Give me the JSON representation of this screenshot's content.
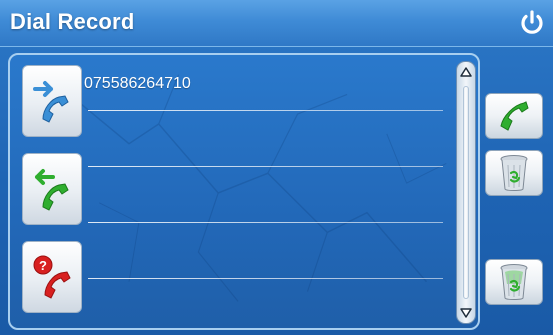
{
  "header": {
    "title": "Dial Record"
  },
  "records": [
    {
      "number": "075586264710"
    }
  ],
  "colors": {
    "background": "#1e64b4",
    "panel_border": "#a8cff0",
    "dial_green": "#2fae2f",
    "missed_red": "#d82020",
    "outgoing_blue": "#3a8fd6"
  },
  "icons": {
    "power": "power-icon",
    "outgoing_tab": "outgoing-call-icon",
    "incoming_tab": "incoming-call-icon",
    "missed_tab": "missed-call-icon",
    "dial": "phone-handset-icon",
    "delete": "trash-icon",
    "delete_all": "trash-full-icon"
  }
}
